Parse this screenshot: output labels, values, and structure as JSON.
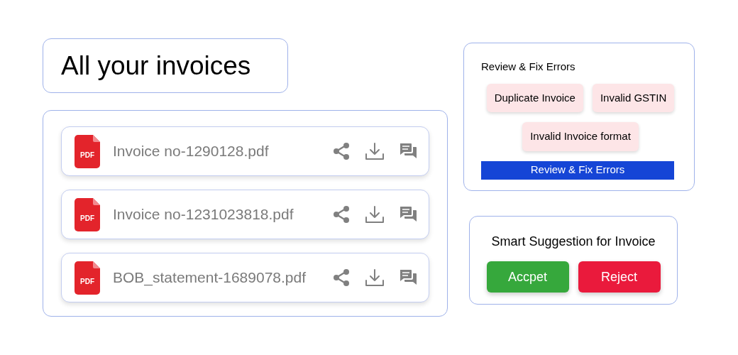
{
  "heading": "All your invoices",
  "files": [
    {
      "icon_label": "PDF",
      "name": "Invoice no-1290128.pdf"
    },
    {
      "icon_label": "PDF",
      "name": "Invoice no-1231023818.pdf"
    },
    {
      "icon_label": "PDF",
      "name": "BOB_statement-1689078.pdf"
    }
  ],
  "errors_card": {
    "title": "Review & Fix Errors",
    "tags": [
      "Duplicate Invoice",
      "Invalid GSTIN",
      "Invalid Invoice format"
    ],
    "button": "Review & Fix Errors"
  },
  "suggestion_card": {
    "title": "Smart Suggestion for Invoice",
    "buttons": [
      {
        "kind": "accept",
        "label": "Accpet"
      },
      {
        "kind": "reject",
        "label": "Reject"
      }
    ]
  }
}
